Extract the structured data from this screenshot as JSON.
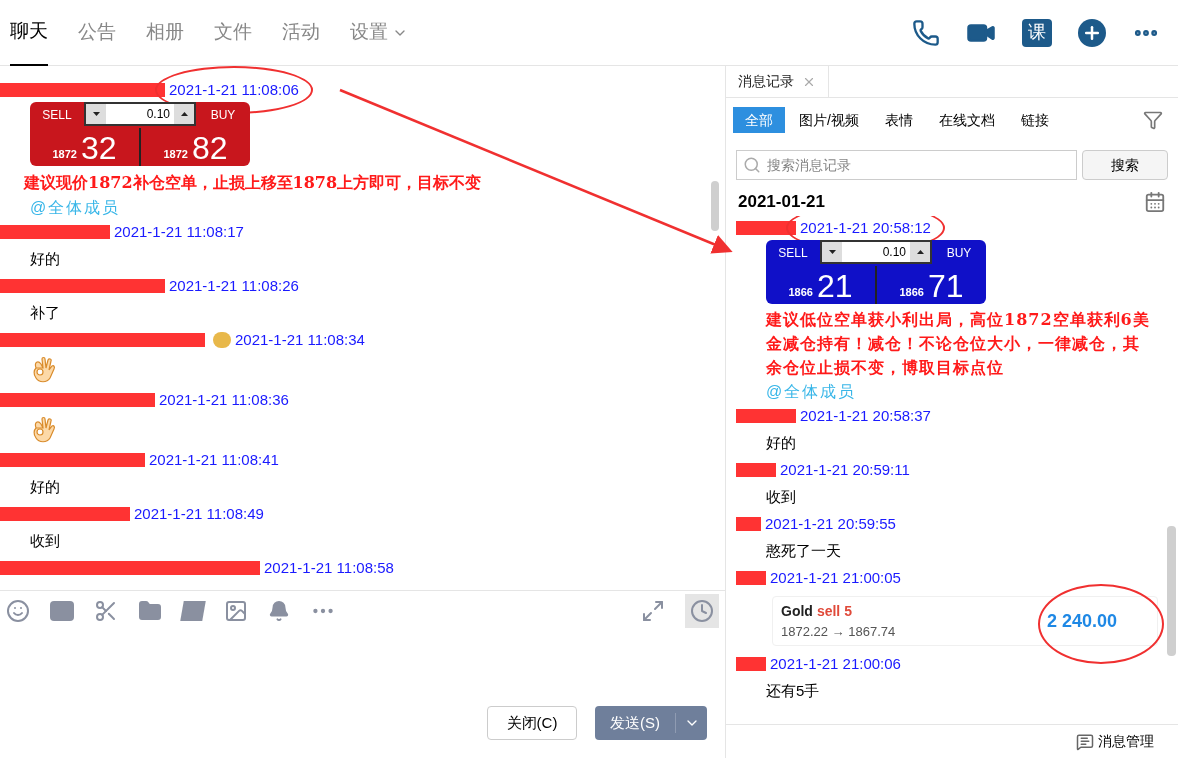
{
  "header": {
    "tabs": [
      {
        "label": "聊天",
        "selected": true
      },
      {
        "label": "公告",
        "selected": false
      },
      {
        "label": "相册",
        "selected": false
      },
      {
        "label": "文件",
        "selected": false
      },
      {
        "label": "活动",
        "selected": false
      },
      {
        "label": "设置",
        "selected": false,
        "dropdown": true
      }
    ],
    "course_badge": "课"
  },
  "chat": {
    "messages": [
      {
        "time": "2021-1-21 11:08:06",
        "circled": true,
        "kind": "signal",
        "widget": {
          "color": "#c8161d",
          "sell": "SELL",
          "buy": "BUY",
          "lot": "0.10",
          "sell_small": "1872",
          "sell_big": "32",
          "buy_small": "1872",
          "buy_big": "82"
        },
        "text": "建议现价1872补仓空单，止损上移至1878上方即可，目标不变",
        "mention": "@全体成员"
      },
      {
        "time": "2021-1-21 11:08:17",
        "kind": "text",
        "text": "好的"
      },
      {
        "time": "2021-1-21 11:08:26",
        "kind": "text",
        "text": "补了"
      },
      {
        "time": "2021-1-21 11:08:34",
        "kind": "sticker",
        "badge": true
      },
      {
        "time": "2021-1-21 11:08:36",
        "kind": "sticker",
        "badge": false
      },
      {
        "time": "2021-1-21 11:08:41",
        "kind": "text",
        "text": "好的"
      },
      {
        "time": "2021-1-21 11:08:49",
        "kind": "text",
        "text": "收到"
      },
      {
        "time": "2021-1-21 11:08:58",
        "kind": "none"
      }
    ]
  },
  "composer": {
    "buttons": [
      {
        "label": "关闭(C)",
        "kind": "plain"
      },
      {
        "label": "发送(S)",
        "kind": "primary"
      }
    ]
  },
  "history": {
    "title": "消息记录",
    "filters": [
      {
        "label": "全部",
        "selected": true
      },
      {
        "label": "图片/视频",
        "selected": false
      },
      {
        "label": "表情",
        "selected": false
      },
      {
        "label": "在线文档",
        "selected": false
      },
      {
        "label": "链接",
        "selected": false
      }
    ],
    "search": {
      "placeholder": "搜索消息记录",
      "button": "搜索"
    },
    "date": "2021-01-21",
    "messages": [
      {
        "time": "2021-1-21 20:58:12",
        "circled": true,
        "kind": "signal",
        "widget": {
          "color": "#1010c8",
          "sell": "SELL",
          "buy": "BUY",
          "lot": "0.10",
          "sell_small": "1866",
          "sell_big": "21",
          "buy_small": "1866",
          "buy_big": "71"
        },
        "text": "建议低位空单获小利出局，高位1872空单获利6美金减仓持有！减仓！不论仓位大小，一律减仓，其余仓位止损不变，博取目标点位",
        "mention": "@全体成员"
      },
      {
        "time": "2021-1-21 20:58:37",
        "kind": "text",
        "text": "好的"
      },
      {
        "time": "2021-1-21 20:59:11",
        "kind": "text",
        "text": "收到"
      },
      {
        "time": "2021-1-21 20:59:55",
        "kind": "text",
        "text": "憨死了一天"
      },
      {
        "time": "2021-1-21 21:00:05",
        "kind": "trade",
        "trade": {
          "circled": true,
          "symbol": "Gold",
          "side": "sell 5",
          "prices": "1872.22 → 1867.74",
          "profit": "2 240.00"
        }
      },
      {
        "time": "2021-1-21 21:00:06",
        "kind": "text",
        "text": "还有5手"
      }
    ],
    "footer": "消息管理"
  }
}
